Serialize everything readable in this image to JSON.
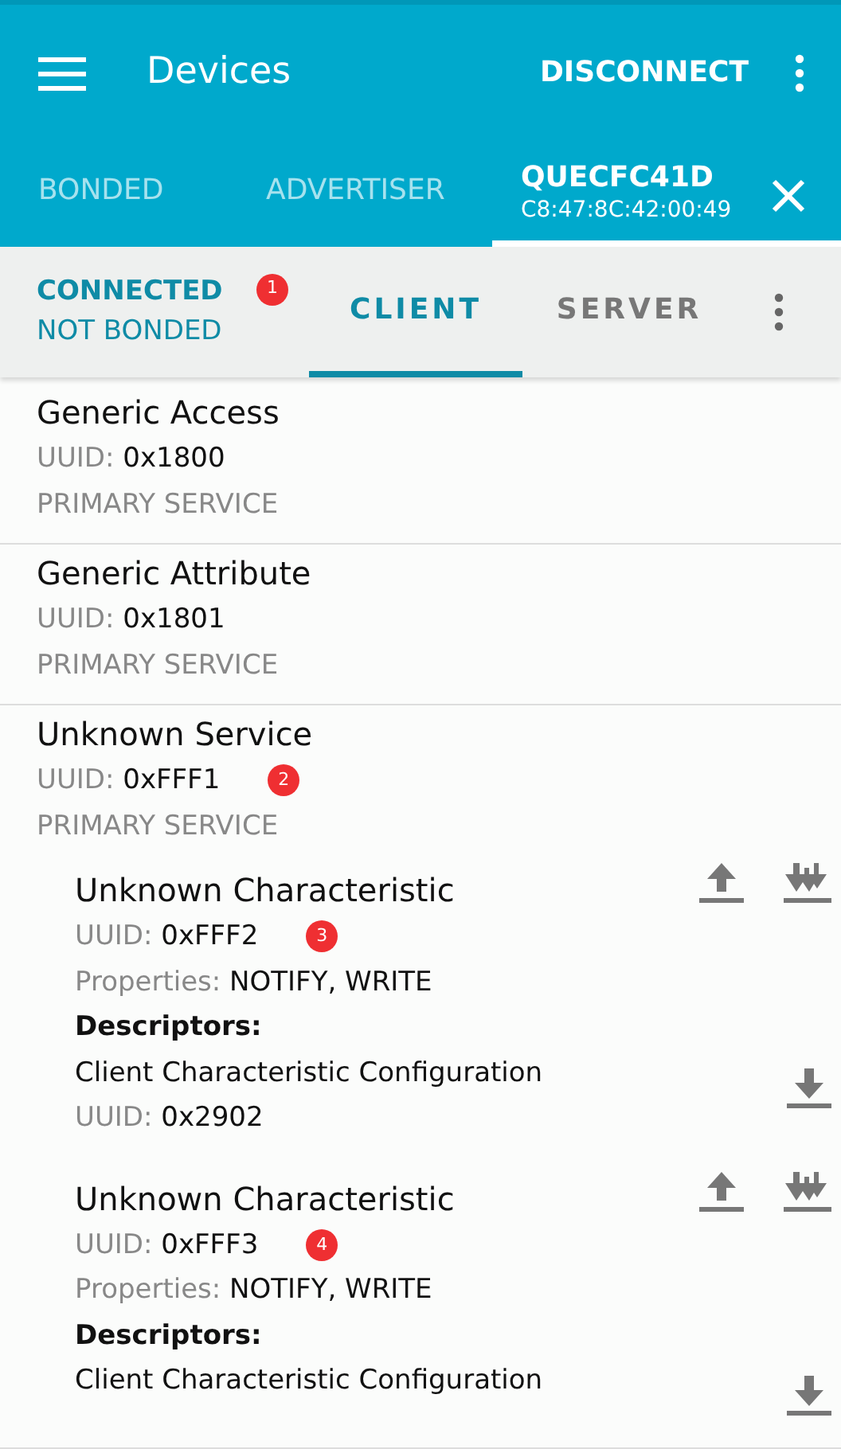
{
  "app_bar": {
    "title": "Devices",
    "action": "DISCONNECT"
  },
  "device_tabs": [
    {
      "label": "BONDED",
      "selected": false
    },
    {
      "label": "ADVERTISER",
      "selected": false
    },
    {
      "label": "QUECFC41D",
      "address": "C8:47:8C:42:00:49",
      "selected": true
    }
  ],
  "connection": {
    "state": "CONNECTED",
    "bond": "NOT BONDED",
    "marker": "1"
  },
  "role_tabs": [
    {
      "label": "CLIENT",
      "selected": true
    },
    {
      "label": "SERVER",
      "selected": false
    }
  ],
  "services": [
    {
      "name": "Generic Access",
      "uuid_label": "UUID:",
      "uuid": "0x1800",
      "type": "PRIMARY SERVICE"
    },
    {
      "name": "Generic Attribute",
      "uuid_label": "UUID:",
      "uuid": "0x1801",
      "type": "PRIMARY SERVICE"
    },
    {
      "name": "Unknown Service",
      "uuid_label": "UUID:",
      "uuid": "0xFFF1",
      "type": "PRIMARY SERVICE",
      "marker": "2",
      "characteristics": [
        {
          "name": "Unknown Characteristic",
          "uuid_label": "UUID:",
          "uuid": "0xFFF2",
          "marker": "3",
          "properties_label": "Properties:",
          "properties": "NOTIFY, WRITE",
          "descriptors_label": "Descriptors:",
          "descriptors": [
            {
              "name": "Client Characteristic Configuration",
              "uuid_label": "UUID:",
              "uuid": "0x2902"
            }
          ]
        },
        {
          "name": "Unknown Characteristic",
          "uuid_label": "UUID:",
          "uuid": "0xFFF3",
          "marker": "4",
          "properties_label": "Properties:",
          "properties": "NOTIFY, WRITE",
          "descriptors_label": "Descriptors:",
          "descriptors": [
            {
              "name": "Client Characteristic Configuration"
            }
          ]
        }
      ]
    }
  ]
}
